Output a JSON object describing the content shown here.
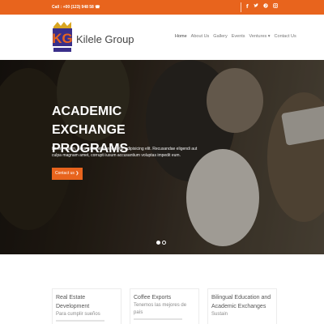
{
  "topbar": {
    "call_text": "Call : +00 (123) 948 58",
    "phone_icon": "phone-icon",
    "social": [
      {
        "name": "facebook-icon",
        "glyph": "f"
      },
      {
        "name": "twitter-icon",
        "glyph": "🐦"
      },
      {
        "name": "pinterest-icon",
        "glyph": "P"
      },
      {
        "name": "instagram-icon",
        "glyph": "◎"
      }
    ]
  },
  "header": {
    "logo_text": "KG",
    "brand": "Kilele Group",
    "nav": [
      {
        "label": "Home",
        "active": true
      },
      {
        "label": "About Us"
      },
      {
        "label": "Gallery"
      },
      {
        "label": "Events"
      },
      {
        "label": "Ventures ▾"
      },
      {
        "label": "Contact Us"
      }
    ]
  },
  "hero": {
    "title": "ACADEMIC EXCHANGE PROGRAMS",
    "description": "Lorem ipsum, dolor sit amet consectetur adipisicing elit. Recusandae eligendi aut culpa magnam amet, corrupti iusum accusantium voluptas impedit eum.",
    "cta_label": "Contact us",
    "cta_icon": "chevron-right-icon"
  },
  "cards": [
    {
      "title": "Real Estate Development",
      "subtitle": "Para cumplir sueños"
    },
    {
      "title": "Coffee Exports",
      "subtitle": "Tenemos las mejores de país"
    },
    {
      "title": "Bilingual Education and Academic Exchanges",
      "subtitle": "Sustain"
    }
  ],
  "colors": {
    "accent": "#e8641d",
    "text_dark": "#444444"
  }
}
